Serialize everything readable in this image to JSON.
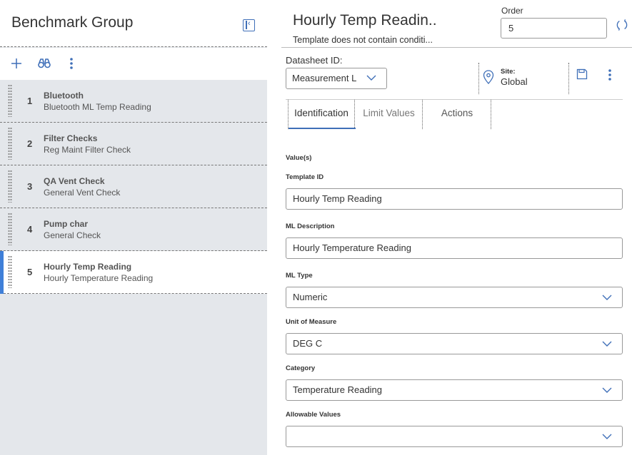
{
  "left": {
    "title": "Benchmark Group",
    "items": [
      {
        "num": "1",
        "title": "Bluetooth",
        "sub": "Bluetooth ML Temp Reading"
      },
      {
        "num": "2",
        "title": "Filter Checks",
        "sub": "Reg Maint Filter Check"
      },
      {
        "num": "3",
        "title": "QA Vent Check",
        "sub": "General Vent Check"
      },
      {
        "num": "4",
        "title": "Pump char",
        "sub": "General Check"
      },
      {
        "num": "5",
        "title": "Hourly Temp Reading",
        "sub": "Hourly Temperature Reading"
      }
    ],
    "active_index": 4
  },
  "header": {
    "title": "Hourly Temp Readin..",
    "subtitle": "Template does not contain conditi...",
    "order_label": "Order",
    "order_value": "5"
  },
  "datasheet": {
    "label": "Datasheet ID:",
    "value": "Measurement Lo"
  },
  "site": {
    "label": "Site:",
    "value": "Global"
  },
  "tabs": [
    {
      "label": "Identification"
    },
    {
      "label": "Limit Values"
    },
    {
      "label": "Actions"
    }
  ],
  "form": {
    "section_label": "Value(s)",
    "template_id": {
      "label": "Template ID",
      "value": "Hourly Temp Reading"
    },
    "ml_description": {
      "label": "ML Description",
      "value": "Hourly Temperature Reading"
    },
    "ml_type": {
      "label": "ML Type",
      "value": "Numeric"
    },
    "unit_of_measure": {
      "label": "Unit of Measure",
      "value": "DEG C"
    },
    "category": {
      "label": "Category",
      "value": "Temperature Reading"
    },
    "allowable_values": {
      "label": "Allowable Values",
      "value": ""
    }
  },
  "colors": {
    "accent": "#3f6fb8",
    "active_bar": "#3f7fd8",
    "list_bg": "#e4e7eb"
  }
}
